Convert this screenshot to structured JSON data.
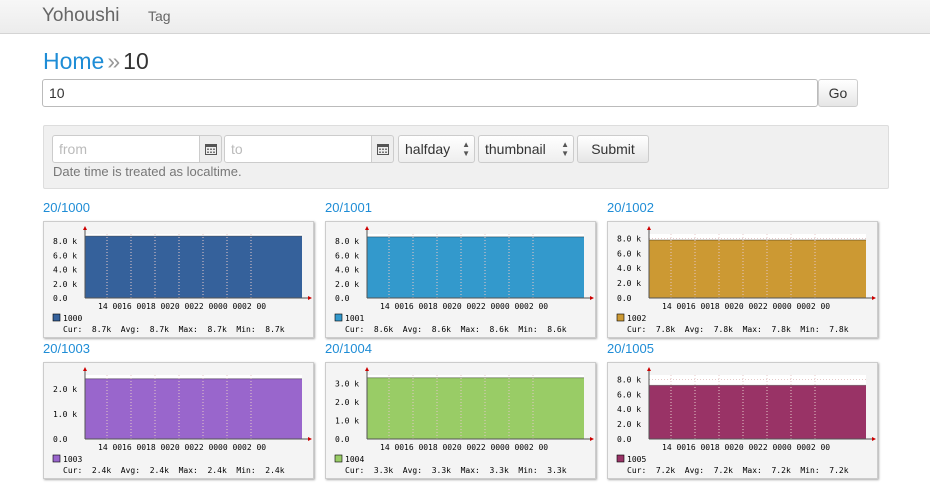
{
  "navbar": {
    "brand": "Yohoushi",
    "tag": "Tag"
  },
  "breadcrumb": {
    "home": "Home",
    "separator": "»",
    "current": "10"
  },
  "search": {
    "value": "10",
    "go_label": "Go"
  },
  "filter": {
    "from_placeholder": "from",
    "to_placeholder": "to",
    "period": "halfday",
    "size": "thumbnail",
    "submit_label": "Submit",
    "note": "Date time is treated as localtime.",
    "calendar_icon": "calendar-icon"
  },
  "x_ticks": [
    "14 00",
    "16 00",
    "18 00",
    "20 00",
    "22 00",
    "00 00",
    "02 00"
  ],
  "graphs": [
    {
      "title": "20/1000",
      "legend": "1000",
      "color": "#35619b",
      "stats": "Cur:  8.7k  Avg:  8.7k  Max:  8.7k  Min:  8.7k",
      "chart_data": {
        "type": "area",
        "value": 8700,
        "ylim": [
          0,
          9000
        ],
        "yticks": [
          "0.0",
          "2.0 k",
          "4.0 k",
          "6.0 k",
          "8.0 k"
        ]
      }
    },
    {
      "title": "20/1001",
      "legend": "1001",
      "color": "#3399cc",
      "stats": "Cur:  8.6k  Avg:  8.6k  Max:  8.6k  Min:  8.6k",
      "chart_data": {
        "type": "area",
        "value": 8600,
        "ylim": [
          0,
          9000
        ],
        "yticks": [
          "0.0",
          "2.0 k",
          "4.0 k",
          "6.0 k",
          "8.0 k"
        ]
      }
    },
    {
      "title": "20/1002",
      "legend": "1002",
      "color": "#cc9933",
      "stats": "Cur:  7.8k  Avg:  7.8k  Max:  7.8k  Min:  7.8k",
      "chart_data": {
        "type": "area",
        "value": 7800,
        "ylim": [
          0,
          8600
        ],
        "yticks": [
          "0.0",
          "2.0 k",
          "4.0 k",
          "6.0 k",
          "8.0 k"
        ]
      }
    },
    {
      "title": "20/1003",
      "legend": "1003",
      "color": "#9966cc",
      "stats": "Cur:  2.4k  Avg:  2.4k  Max:  2.4k  Min:  2.4k",
      "chart_data": {
        "type": "area",
        "value": 2400,
        "ylim": [
          0,
          2550
        ],
        "yticks": [
          "0.0",
          "1.0 k",
          "2.0 k"
        ]
      }
    },
    {
      "title": "20/1004",
      "legend": "1004",
      "color": "#99cc66",
      "stats": "Cur:  3.3k  Avg:  3.3k  Max:  3.3k  Min:  3.3k",
      "chart_data": {
        "type": "area",
        "value": 3300,
        "ylim": [
          0,
          3450
        ],
        "yticks": [
          "0.0",
          "1.0 k",
          "2.0 k",
          "3.0 k"
        ]
      }
    },
    {
      "title": "20/1005",
      "legend": "1005",
      "color": "#993366",
      "stats": "Cur:  7.2k  Avg:  7.2k  Max:  7.2k  Min:  7.2k",
      "chart_data": {
        "type": "area",
        "value": 7200,
        "ylim": [
          0,
          8600
        ],
        "yticks": [
          "0.0",
          "2.0 k",
          "4.0 k",
          "6.0 k",
          "8.0 k"
        ]
      }
    }
  ]
}
